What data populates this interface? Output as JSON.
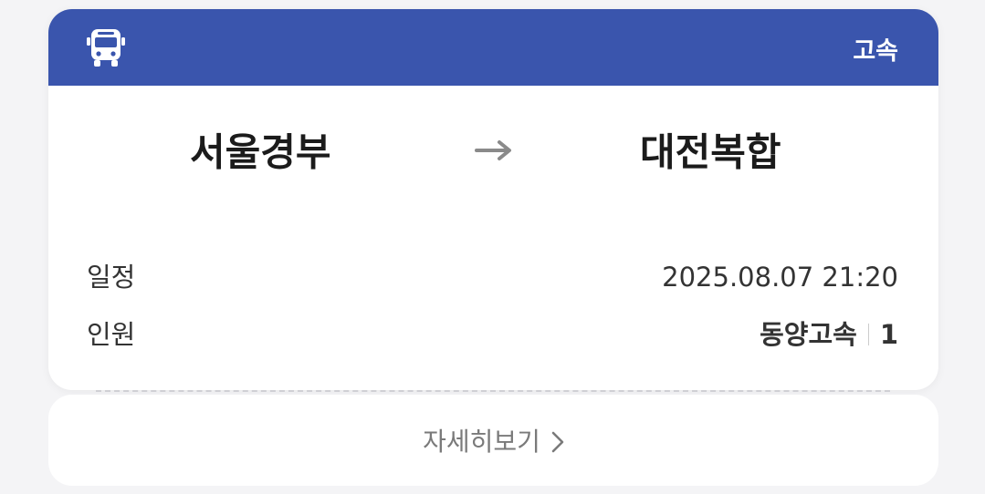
{
  "header": {
    "icon": "bus-icon",
    "bus_type": "고속",
    "color": "#3a55ad"
  },
  "route": {
    "origin": "서울경부",
    "arrow_icon": "arrow-right-icon",
    "destination": "대전복합"
  },
  "schedule": {
    "label": "일정",
    "value": "2025.08.07 21:20"
  },
  "passengers": {
    "label": "인원",
    "company": "동양고속",
    "count": "1"
  },
  "details": {
    "label": "자세히보기",
    "icon": "chevron-right-icon"
  }
}
